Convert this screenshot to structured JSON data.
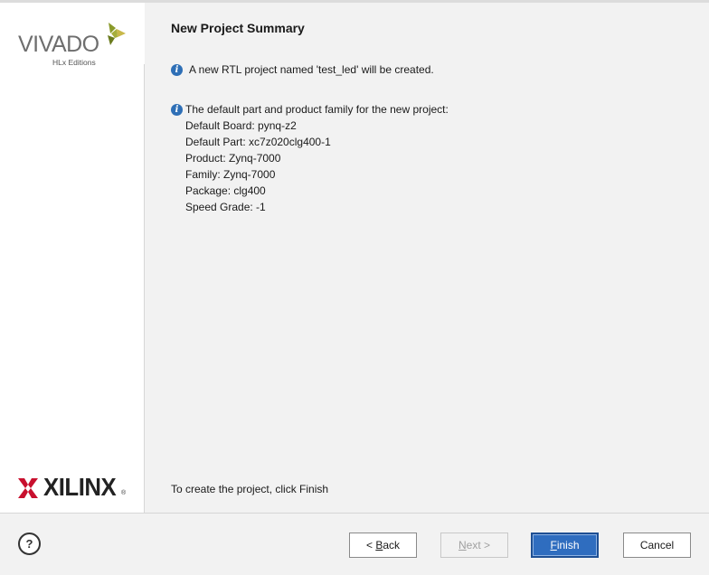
{
  "brand": {
    "vivado_name": "VIVADO",
    "vivado_edition": "HLx Editions",
    "xilinx_name": "XILINX",
    "xilinx_reg": "®",
    "colors": {
      "vivado_leaf": "#8a9a2a",
      "xilinx_red": "#c8102e"
    }
  },
  "page": {
    "title": "New Project Summary",
    "info1": "A new RTL project named 'test_led' will be created.",
    "info2": "The default part and product family for the new project:",
    "details": [
      "Default Board: pynq-z2",
      "Default Part: xc7z020clg400-1",
      "Product: Zynq-7000",
      "Family: Zynq-7000",
      "Package: clg400",
      "Speed Grade: -1"
    ],
    "finish_note": "To create the project, click Finish",
    "info_icon": "i"
  },
  "footer": {
    "help_label": "?",
    "back_prefix": "< ",
    "back_mn": "B",
    "back_rest": "ack",
    "next_mn": "N",
    "next_rest": "ext >",
    "finish_mn": "F",
    "finish_rest": "inish",
    "cancel_label": "Cancel"
  }
}
